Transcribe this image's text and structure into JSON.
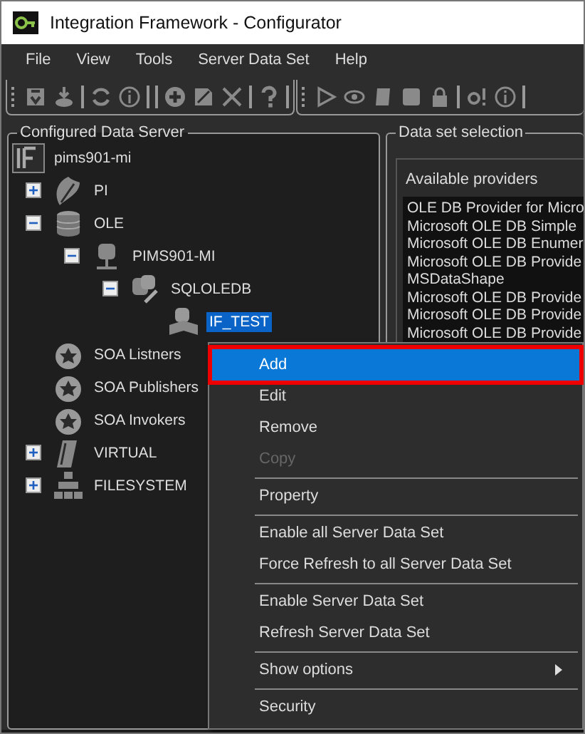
{
  "window": {
    "title": "Integration Framework - Configurator"
  },
  "menu_bar": [
    "File",
    "View",
    "Tools",
    "Server Data Set",
    "Help"
  ],
  "left_panel": {
    "title": "Configured Data Server",
    "tree": [
      {
        "label": "pims901-mi",
        "kind": "root",
        "children": [
          {
            "label": "PI",
            "kind": "pi",
            "expanded": false
          },
          {
            "label": "OLE",
            "kind": "database",
            "expanded": true,
            "children": [
              {
                "label": "PIMS901-MI",
                "kind": "computer",
                "expanded": true,
                "children": [
                  {
                    "label": "SQLOLEDB",
                    "kind": "provider",
                    "expanded": true,
                    "children": [
                      {
                        "label": "IF_TEST",
                        "kind": "dataset",
                        "selected": true
                      }
                    ]
                  }
                ]
              }
            ]
          },
          {
            "label": "SOA Listners",
            "kind": "soa",
            "selected": false
          },
          {
            "label": "SOA Publishers",
            "kind": "soa",
            "selected": false
          },
          {
            "label": "SOA Invokers",
            "kind": "soa",
            "selected": false
          },
          {
            "label": "VIRTUAL",
            "kind": "virtual",
            "expanded": false
          },
          {
            "label": "FILESYSTEM",
            "kind": "filesystem",
            "expanded": false
          }
        ]
      }
    ]
  },
  "right_panel": {
    "title": "Data set selection",
    "list_title": "Available providers",
    "providers": [
      "OLE DB Provider for Micro",
      "Microsoft OLE DB Simple",
      "Microsoft OLE DB Enumer",
      "Microsoft OLE DB Provide",
      "MSDataShape",
      "Microsoft OLE DB Provide",
      "Microsoft OLE DB Provide",
      "Microsoft OLE DB Provide"
    ]
  },
  "context_menu": [
    {
      "kind": "item",
      "label": "Add",
      "selected": true,
      "disabled": false,
      "annotated": true
    },
    {
      "kind": "item",
      "label": "Edit",
      "selected": false,
      "disabled": false,
      "annotated": false
    },
    {
      "kind": "item",
      "label": "Remove",
      "selected": false,
      "disabled": false,
      "annotated": false
    },
    {
      "kind": "item",
      "label": "Copy",
      "selected": false,
      "disabled": true,
      "annotated": false
    },
    {
      "kind": "separator"
    },
    {
      "kind": "item",
      "label": "Property",
      "selected": false,
      "disabled": false,
      "annotated": false
    },
    {
      "kind": "separator"
    },
    {
      "kind": "item",
      "label": "Enable all Server Data Set",
      "selected": false,
      "disabled": false,
      "annotated": false
    },
    {
      "kind": "item",
      "label": "Force Refresh to all Server Data Set",
      "selected": false,
      "disabled": false,
      "annotated": false
    },
    {
      "kind": "separator"
    },
    {
      "kind": "item",
      "label": "Enable Server Data Set",
      "selected": false,
      "disabled": false,
      "annotated": false
    },
    {
      "kind": "item",
      "label": "Refresh Server Data Set",
      "selected": false,
      "disabled": false,
      "annotated": false
    },
    {
      "kind": "separator"
    },
    {
      "kind": "submenu",
      "label": "Show options",
      "selected": false,
      "disabled": false,
      "annotated": false
    },
    {
      "kind": "separator"
    },
    {
      "kind": "item",
      "label": "Security",
      "selected": false,
      "disabled": false,
      "annotated": false
    }
  ]
}
